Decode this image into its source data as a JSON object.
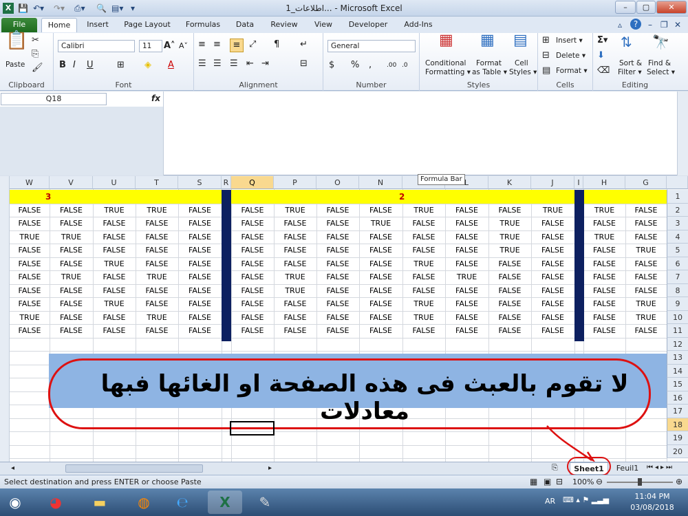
{
  "window": {
    "title": "اطلاعات_1... - Microsoft Excel",
    "minimize": "–",
    "maximize": "▢",
    "close": "✕"
  },
  "ribbon_tabs": [
    "File",
    "Home",
    "Insert",
    "Page Layout",
    "Formulas",
    "Data",
    "Review",
    "View",
    "Developer",
    "Add-Ins"
  ],
  "ribbon": {
    "paste": "Paste",
    "font_name": "Calibri",
    "font_size": "11",
    "number_format": "General",
    "conditional_formatting": [
      "Conditional",
      "Formatting ▾"
    ],
    "format_as_table": [
      "Format",
      "as Table ▾"
    ],
    "cell_styles": [
      "Cell",
      "Styles ▾"
    ],
    "insert": "Insert ▾",
    "delete": "Delete ▾",
    "format": "Format ▾",
    "sort_filter": [
      "Sort &",
      "Filter ▾"
    ],
    "find_select": [
      "Find &",
      "Select ▾"
    ],
    "groups": [
      "Clipboard",
      "Font",
      "Alignment",
      "Number",
      "Styles",
      "Cells",
      "Editing"
    ]
  },
  "formula_bar": {
    "name_box": "Q18",
    "fx": "fx",
    "tooltip": "Formula Bar"
  },
  "columns": [
    "W",
    "V",
    "U",
    "T",
    "S",
    "R",
    "Q",
    "P",
    "O",
    "N",
    "M",
    "L",
    "K",
    "J",
    "I",
    "H",
    "G"
  ],
  "rows": [
    "1",
    "2",
    "3",
    "4",
    "5",
    "6",
    "7",
    "8",
    "9",
    "10",
    "11",
    "12",
    "13",
    "14",
    "15",
    "16",
    "17",
    "18",
    "19",
    "20"
  ],
  "header_labels": {
    "group3": "3",
    "group2": "2"
  },
  "data_rows": [
    [
      "FALSE",
      "FALSE",
      "TRUE",
      "TRUE",
      "FALSE",
      "FALSE",
      "TRUE",
      "FALSE",
      "FALSE",
      "TRUE",
      "FALSE",
      "FALSE",
      "TRUE",
      "TRUE",
      "FALSE"
    ],
    [
      "FALSE",
      "FALSE",
      "FALSE",
      "FALSE",
      "FALSE",
      "FALSE",
      "FALSE",
      "FALSE",
      "TRUE",
      "FALSE",
      "FALSE",
      "TRUE",
      "FALSE",
      "FALSE",
      "FALSE"
    ],
    [
      "TRUE",
      "TRUE",
      "FALSE",
      "FALSE",
      "FALSE",
      "FALSE",
      "FALSE",
      "FALSE",
      "FALSE",
      "FALSE",
      "FALSE",
      "TRUE",
      "FALSE",
      "TRUE",
      "FALSE"
    ],
    [
      "FALSE",
      "FALSE",
      "FALSE",
      "FALSE",
      "FALSE",
      "FALSE",
      "FALSE",
      "FALSE",
      "FALSE",
      "FALSE",
      "FALSE",
      "TRUE",
      "FALSE",
      "FALSE",
      "TRUE"
    ],
    [
      "FALSE",
      "FALSE",
      "TRUE",
      "FALSE",
      "FALSE",
      "FALSE",
      "FALSE",
      "FALSE",
      "FALSE",
      "TRUE",
      "FALSE",
      "FALSE",
      "FALSE",
      "FALSE",
      "FALSE"
    ],
    [
      "FALSE",
      "TRUE",
      "FALSE",
      "TRUE",
      "FALSE",
      "FALSE",
      "TRUE",
      "FALSE",
      "FALSE",
      "FALSE",
      "TRUE",
      "FALSE",
      "FALSE",
      "FALSE",
      "FALSE"
    ],
    [
      "FALSE",
      "FALSE",
      "FALSE",
      "FALSE",
      "FALSE",
      "FALSE",
      "TRUE",
      "FALSE",
      "FALSE",
      "FALSE",
      "FALSE",
      "FALSE",
      "FALSE",
      "FALSE",
      "FALSE"
    ],
    [
      "FALSE",
      "FALSE",
      "TRUE",
      "FALSE",
      "FALSE",
      "FALSE",
      "FALSE",
      "FALSE",
      "FALSE",
      "TRUE",
      "FALSE",
      "FALSE",
      "FALSE",
      "FALSE",
      "TRUE"
    ],
    [
      "TRUE",
      "FALSE",
      "FALSE",
      "TRUE",
      "FALSE",
      "FALSE",
      "FALSE",
      "FALSE",
      "FALSE",
      "TRUE",
      "FALSE",
      "FALSE",
      "FALSE",
      "FALSE",
      "TRUE"
    ],
    [
      "FALSE",
      "FALSE",
      "FALSE",
      "FALSE",
      "FALSE",
      "FALSE",
      "FALSE",
      "FALSE",
      "FALSE",
      "FALSE",
      "FALSE",
      "FALSE",
      "FALSE",
      "FALSE",
      "FALSE"
    ]
  ],
  "banner_text": "لا تقوم بالعبث فى هذه الصفحة او الغائها فبها معادلات",
  "sheet_tabs": [
    "Sheet1",
    "Feuil1"
  ],
  "status": {
    "message": "Select destination and press ENTER or choose Paste",
    "zoom": "100%"
  },
  "taskbar": {
    "lang": "AR",
    "time": "11:04 PM",
    "date": "03/08/2018"
  }
}
